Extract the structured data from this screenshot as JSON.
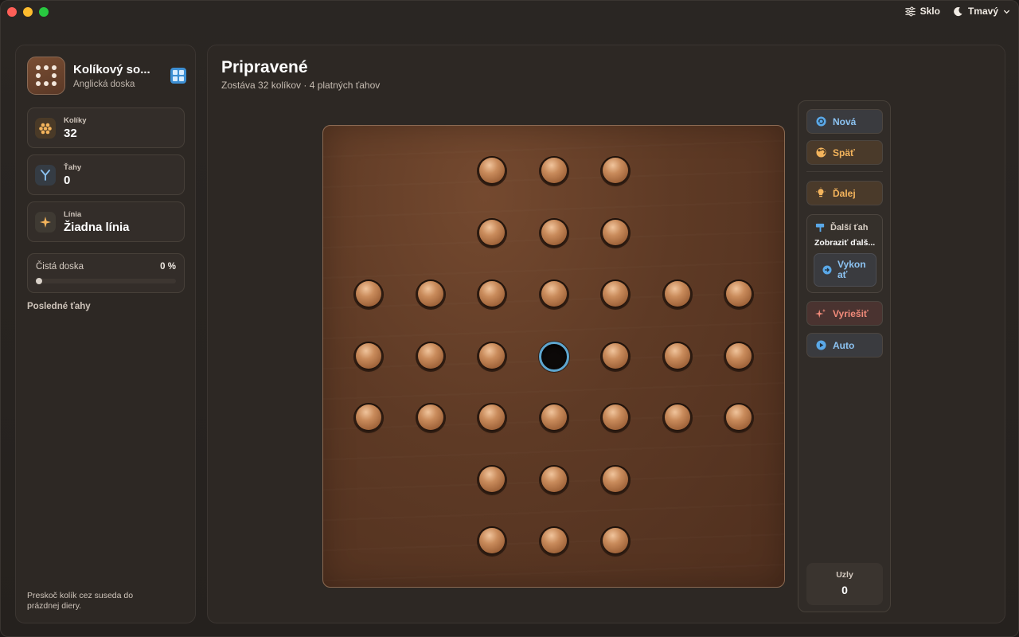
{
  "toolbar": {
    "glass_label": "Sklo",
    "theme_label": "Tmavý"
  },
  "sidebar": {
    "app_title": "Kolíkový so...",
    "app_subtitle": "Anglická doska",
    "stats": {
      "pegs": {
        "label": "Kolíky",
        "value": "32"
      },
      "moves": {
        "label": "Ťahy",
        "value": "0"
      },
      "line": {
        "label": "Línia",
        "value": "Žiadna línia"
      }
    },
    "clean_board": {
      "label": "Čistá doska",
      "value": "0 %",
      "progress": 0
    },
    "recent_moves_label": "Posledné ťahy",
    "hint": "Preskoč kolík cez suseda do prázdnej diery."
  },
  "main": {
    "title": "Pripravené",
    "subtitle": "Zostáva 32 kolíkov · 4 platných ťahov"
  },
  "board": {
    "type": "english",
    "rows": [
      "..XXX..",
      "..XXX..",
      "XXXXXXX",
      "XXXOXXX",
      "XXXXXXX",
      "..XXX..",
      "..XXX.."
    ],
    "selected_hole": {
      "row": 3,
      "col": 3
    },
    "accent_color": "#5ea6cf"
  },
  "actions": {
    "new_label": "Nová",
    "undo_label": "Späť",
    "next_label": "Ďalej",
    "next_move_title": "Ďalší ťah",
    "next_move_text": "Zobraziť ďalš...",
    "execute_label": "Vykonať",
    "solve_label": "Vyriešiť",
    "auto_label": "Auto",
    "nodes_label": "Uzly",
    "nodes_value": "0"
  }
}
